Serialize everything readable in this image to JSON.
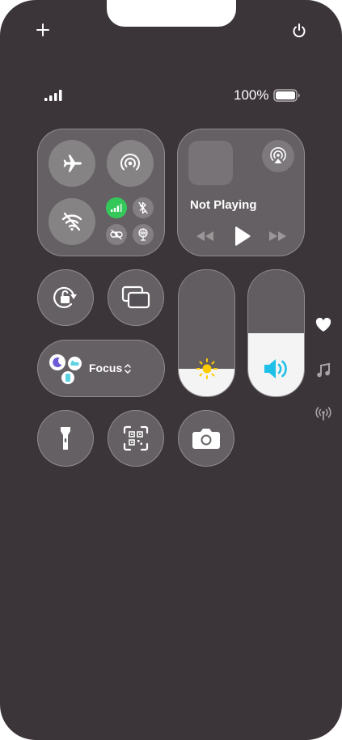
{
  "status_bar": {
    "battery_text": "100%"
  },
  "media": {
    "title": "Not Playing"
  },
  "focus": {
    "label": "Focus"
  },
  "sliders": {
    "brightness_level": 0.22,
    "volume_level": 0.5
  },
  "connectivity": {
    "cellular_active": true,
    "wifi_active": false,
    "bluetooth_active": false,
    "airplane_active": false
  },
  "colors": {
    "background": "#3b3439",
    "cellular_green": "#34c759",
    "speaker_blue": "#1ec0e8",
    "sun_yellow": "#ffcc00",
    "focus_moon_purple": "#6e5cd6",
    "focus_teal": "#5ad2e0"
  },
  "icons": {
    "add": "plus-icon",
    "power": "power-icon",
    "airplane": "airplane-icon",
    "airdrop": "airdrop-icon",
    "wifi": "wifi-off-icon",
    "cellular": "cellular-icon",
    "bluetooth": "bluetooth-off-icon",
    "link": "personal-hotspot-icon",
    "satellite": "satellite-icon",
    "airplay": "airplay-icon",
    "rotation": "rotation-lock-icon",
    "mirror": "screen-mirroring-icon",
    "flashlight": "flashlight-icon",
    "code_scanner": "qr-scanner-icon",
    "camera": "camera-icon",
    "heart": "heart-icon",
    "music": "music-note-icon",
    "signal": "antenna-icon"
  }
}
